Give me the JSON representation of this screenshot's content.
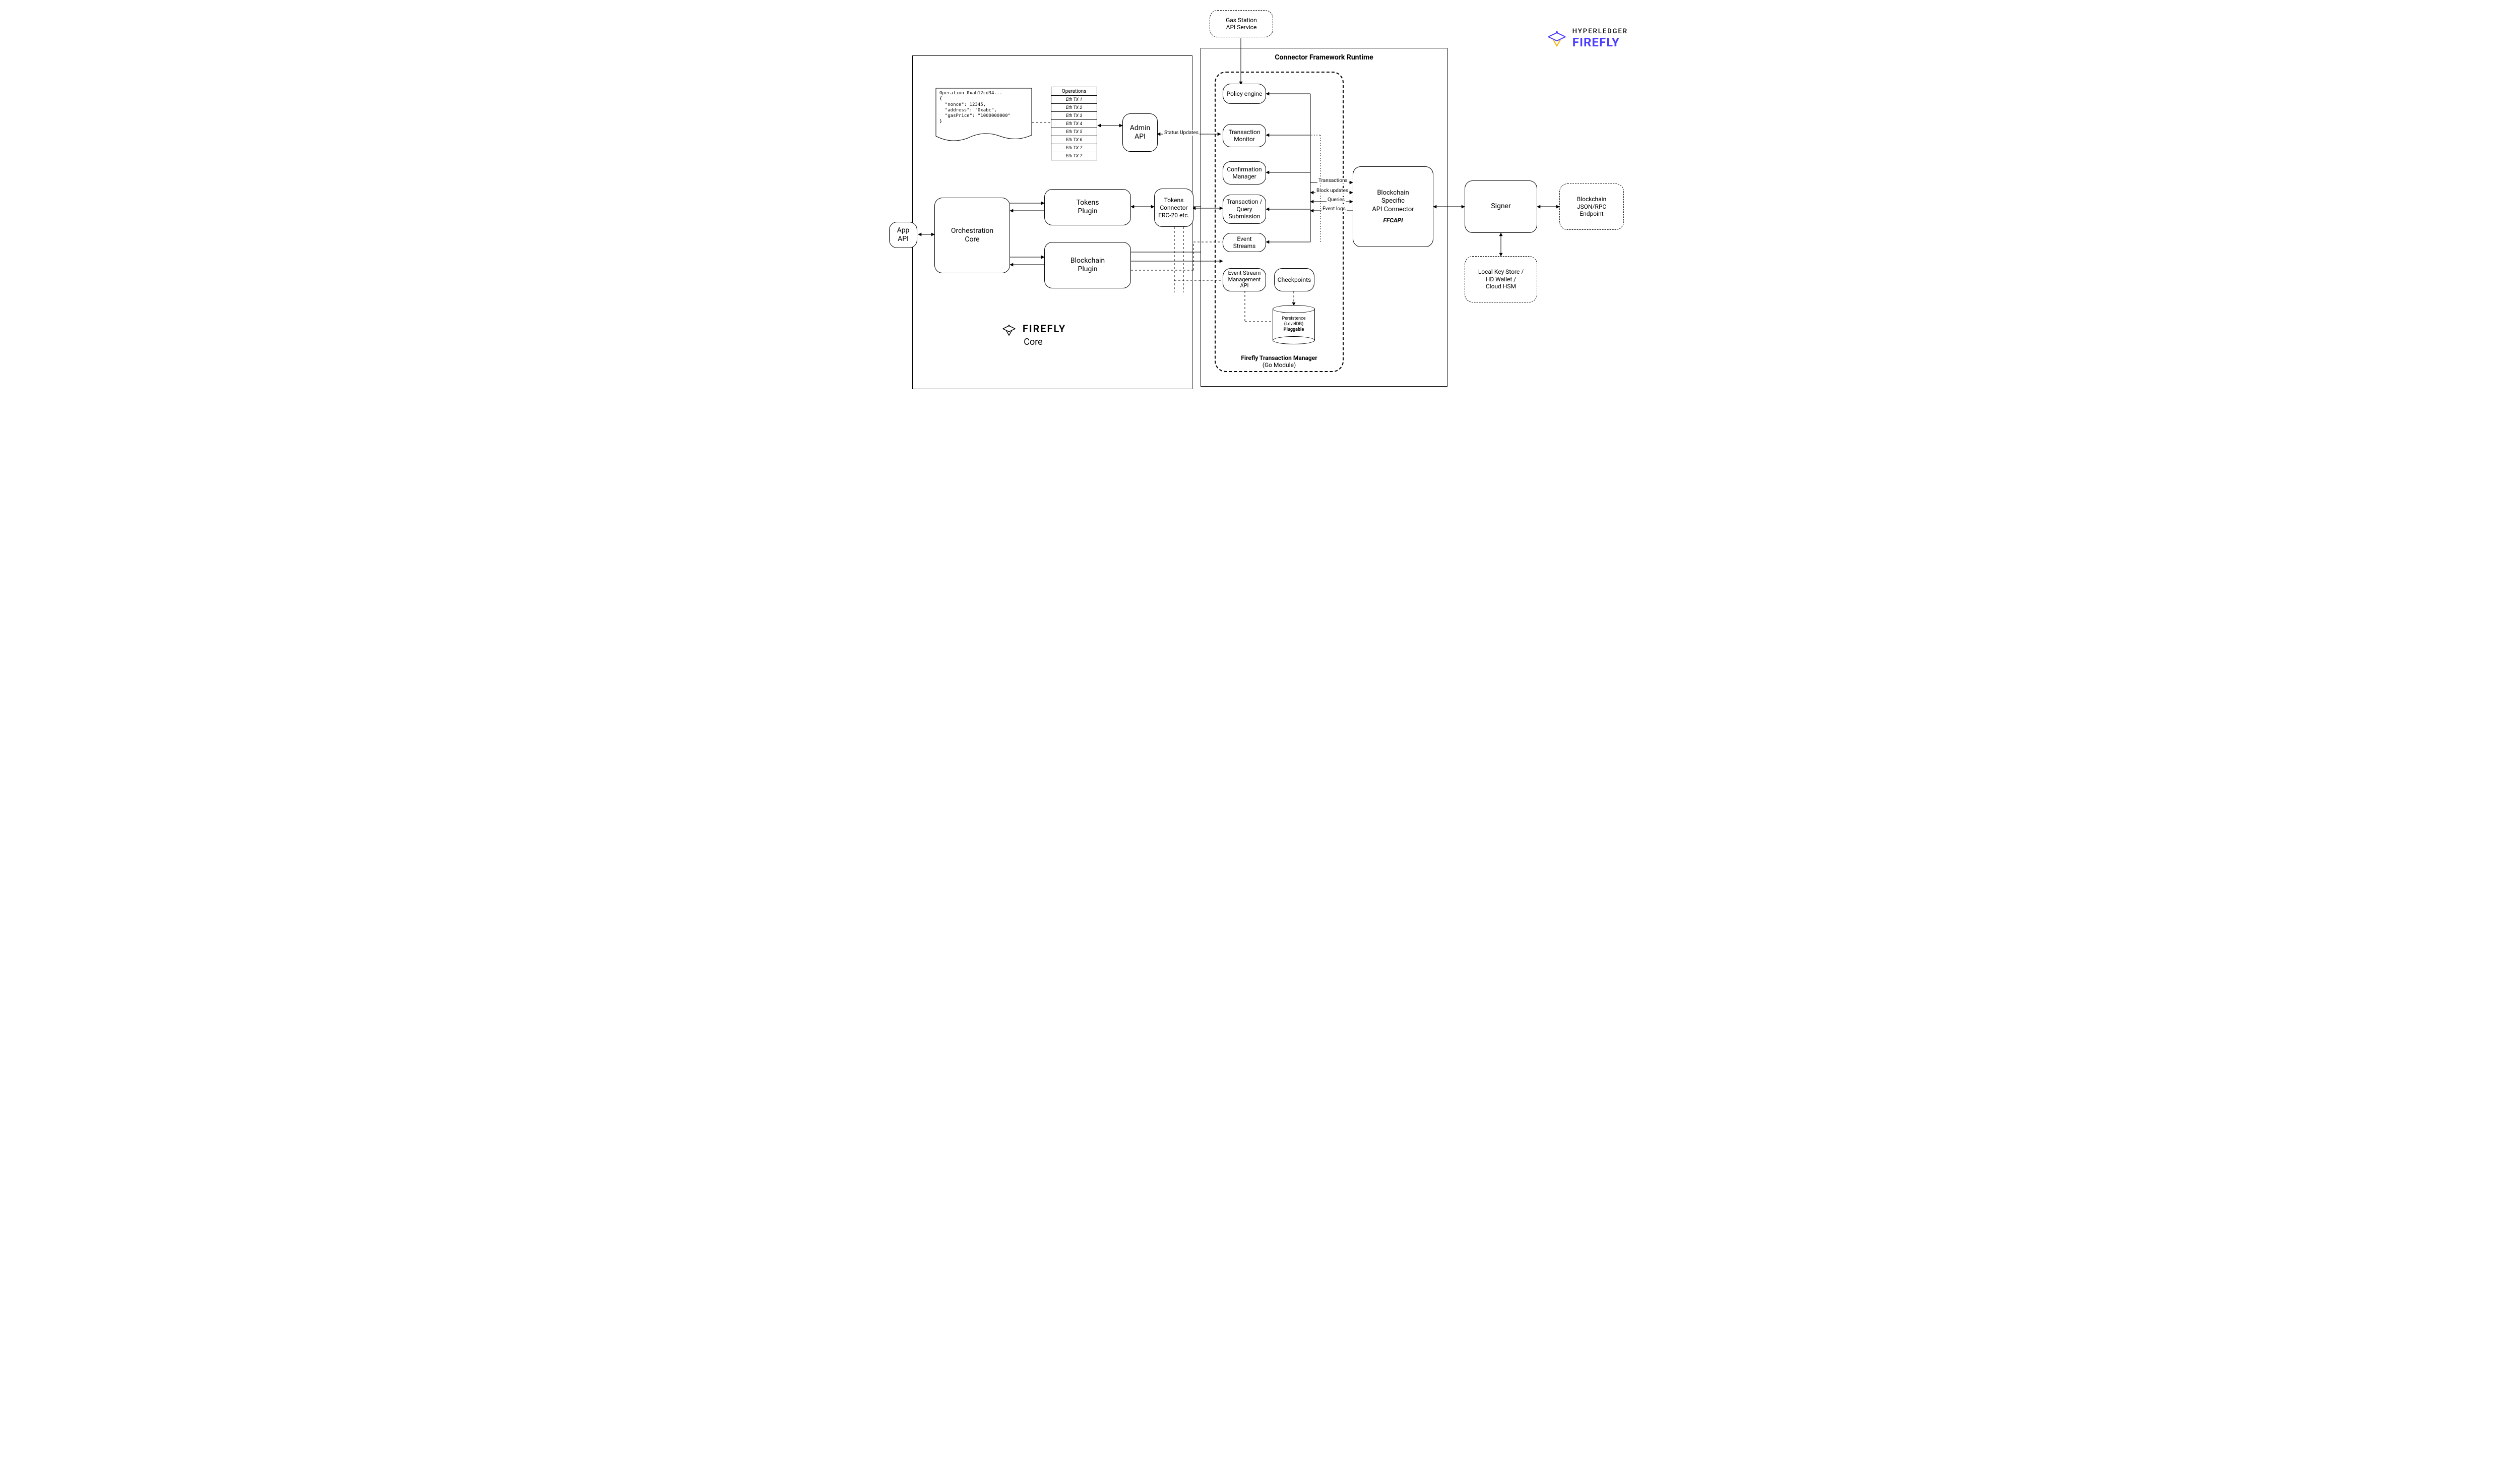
{
  "logo": {
    "line1": "HYPERLEDGER",
    "line2": "FIREFLY"
  },
  "external": {
    "gas_station": "Gas Station\nAPI Service",
    "signer": "Signer",
    "keystore": "Local Key Store /\nHD Wallet /\nCloud HSM",
    "endpoint": "Blockchain\nJSON/RPC\nEndpoint"
  },
  "app_api": "App\nAPI",
  "ffcore": {
    "label_title": "FIREFLY",
    "label_sub": "Core",
    "orchestration": "Orchestration\nCore",
    "tokens_plugin": "Tokens\nPlugin",
    "blockchain_plugin": "Blockchain\nPlugin",
    "admin_api": "Admin\nAPI",
    "tokens_connector": "Tokens\nConnector\nERC-20 etc."
  },
  "op_note": {
    "text": "Operation 0xab12cd34...\n{\n  \"nonce\": 12345,\n  \"address\": \"0xabc\",\n  \"gasPrice\": \"1000000000\"\n}"
  },
  "operations": {
    "header": "Operations",
    "rows": [
      "Eth TX 1",
      "Eth TX 2",
      "Eth TX 3",
      "Eth TX 4",
      "Eth TX 5",
      "Eth TX 6",
      "Eth TX 7",
      "Eth TX 7"
    ]
  },
  "cfr": {
    "title": "Connector Framework Runtime",
    "ftm_title_bold": "Firefly Transaction Manager",
    "ftm_title_sub": "(Go Module)",
    "policy_engine": "Policy engine",
    "tx_monitor": "Transaction\nMonitor",
    "conf_mgr": "Confirmation\nManager",
    "tx_query": "Transaction /\nQuery\nSubmission",
    "event_streams": "Event Streams",
    "esm_api": "Event Stream\nManagement API",
    "checkpoints": "Checkpoints",
    "persistence_l1": "Persistence",
    "persistence_l2": "(LevelDB)",
    "persistence_l3": "Pluggable",
    "ffcapi_l1": "Blockchain",
    "ffcapi_l2": "Specific",
    "ffcapi_l3": "API Connector",
    "ffcapi_l4": "FFCAPI"
  },
  "labels": {
    "status_updates": "Status Updates",
    "transactions": "Transactions",
    "block_updates": "Block updates",
    "queries": "Queries",
    "event_logs": "Event logs"
  }
}
